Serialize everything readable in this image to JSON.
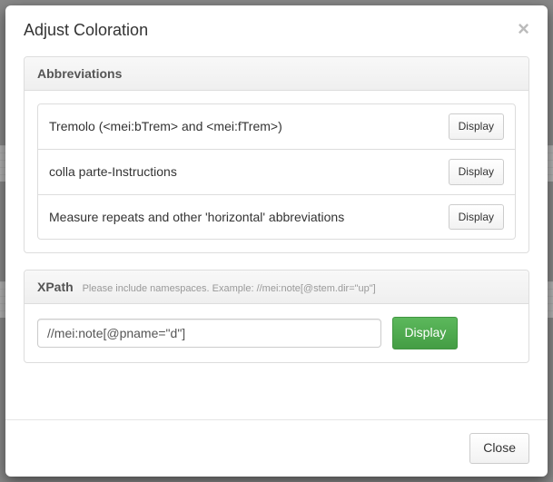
{
  "modal": {
    "title": "Adjust Coloration",
    "close_x": "×"
  },
  "abbreviations": {
    "heading": "Abbreviations",
    "items": [
      {
        "label": "Tremolo (<mei:bTrem> and <mei:fTrem>)",
        "button": "Display"
      },
      {
        "label": "colla parte-Instructions",
        "button": "Display"
      },
      {
        "label": "Measure repeats and other 'horizontal' abbreviations",
        "button": "Display"
      }
    ]
  },
  "xpath": {
    "heading": "XPath",
    "hint": "Please include namespaces. Example: //mei:note[@stem.dir=\"up\"]",
    "input_value": "//mei:note[@pname=\"d\"]",
    "button": "Display"
  },
  "footer": {
    "close_label": "Close"
  }
}
